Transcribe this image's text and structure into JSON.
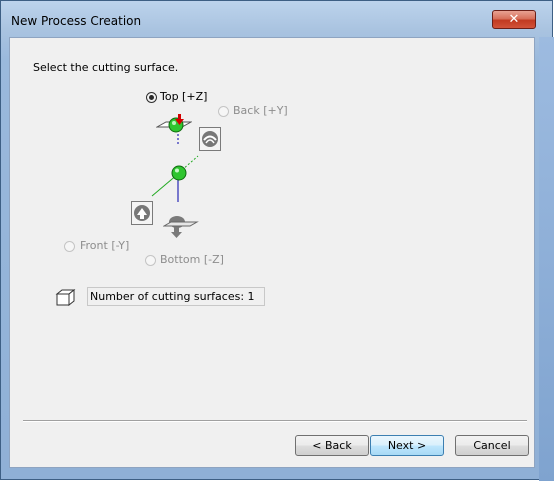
{
  "window": {
    "title": "New Process Creation",
    "close_symbol": "✕"
  },
  "main": {
    "instruction": "Select the cutting surface.",
    "radios": {
      "top": {
        "label": "Top [+Z]",
        "checked": true,
        "enabled": true
      },
      "back": {
        "label": "Back [+Y]",
        "checked": false,
        "enabled": false
      },
      "front": {
        "label": "Front [-Y]",
        "checked": false,
        "enabled": false
      },
      "bottom": {
        "label": "Bottom [-Z]",
        "checked": false,
        "enabled": false
      }
    },
    "surface_count_text": "Number of cutting surfaces: 1"
  },
  "footer": {
    "back_label": "< Back",
    "next_label": "Next >",
    "cancel_label": "Cancel"
  },
  "icons": [
    "close-icon",
    "top-surface-icon",
    "back-view-icon",
    "axis-origin-icon",
    "front-view-icon",
    "bottom-surface-icon",
    "cube-icon"
  ],
  "colors": {
    "title_bar": "#a9c3e0",
    "close_button": "#c13a21",
    "dialog_bg": "#f0f0f0",
    "default_button": "#bee6fd",
    "sphere_green": "#2fc52f",
    "arrow_red": "#d40000",
    "axis_blue": "#0000aa",
    "axis_green": "#22aa22"
  }
}
